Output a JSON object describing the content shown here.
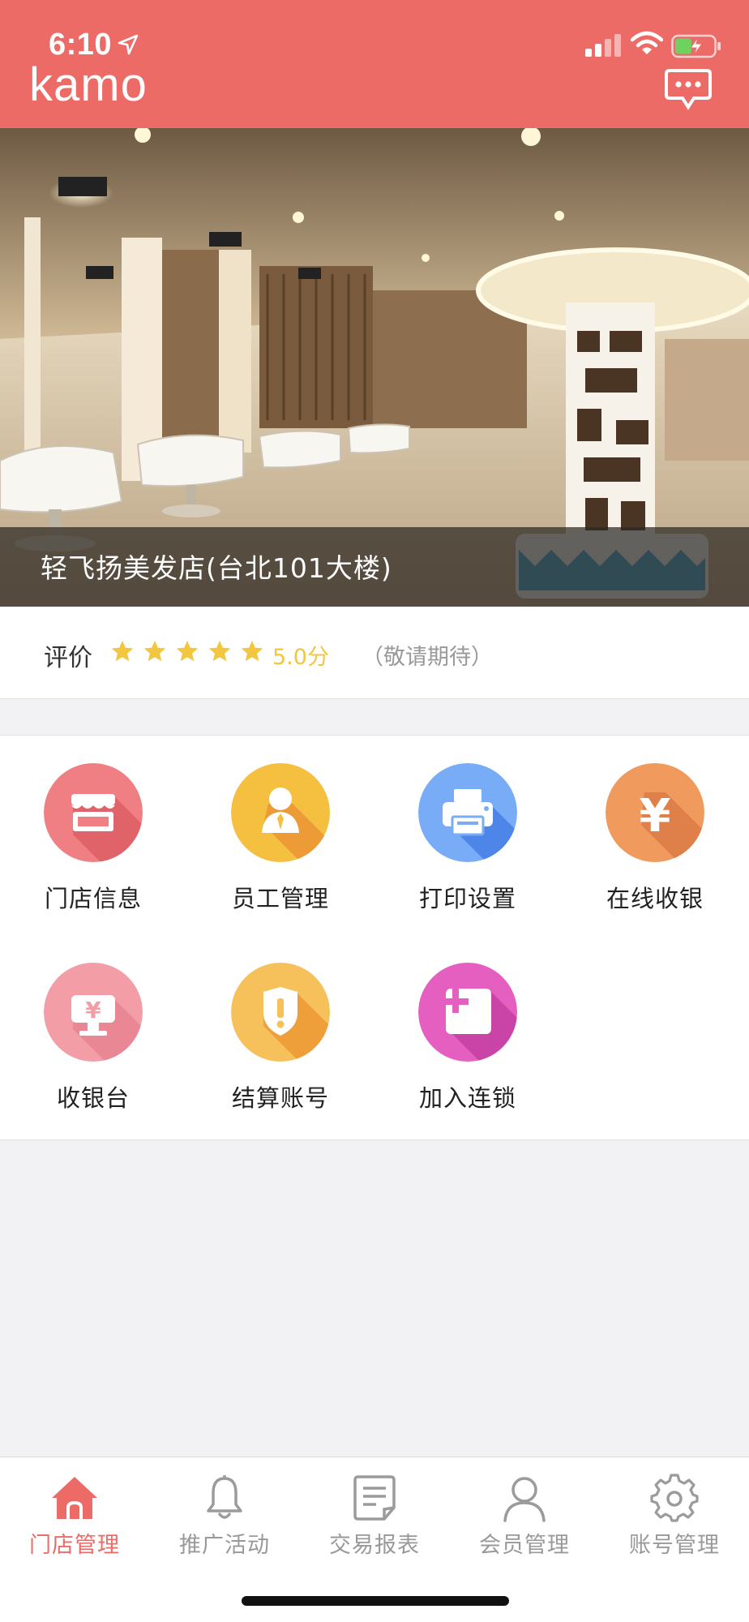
{
  "status_bar": {
    "time": "6:10"
  },
  "header": {
    "logo": "kamo",
    "message_icon": "chat-bubble-icon"
  },
  "hero": {
    "store_name": "轻飞扬美发店(台北101大楼)"
  },
  "rating": {
    "label": "评价",
    "stars": 5,
    "score": "5.0分",
    "note": "（敬请期待）"
  },
  "grid": {
    "items": [
      {
        "label": "门店信息",
        "icon": "storefront-icon",
        "color": "#f07f84"
      },
      {
        "label": "员工管理",
        "icon": "staff-icon",
        "color": "#f5bf3f"
      },
      {
        "label": "打印设置",
        "icon": "printer-icon",
        "color": "#78acf6"
      },
      {
        "label": "在线收银",
        "icon": "yen-icon",
        "color": "#f09a5e"
      },
      {
        "label": "收银台",
        "icon": "cashier-icon",
        "color": "#f39ea7"
      },
      {
        "label": "结算账号",
        "icon": "shield-alert-icon",
        "color": "#f6c15a"
      },
      {
        "label": "加入连锁",
        "icon": "join-chain-icon",
        "color": "#e45fc0"
      }
    ]
  },
  "tabbar": {
    "active_color": "#ec6b67",
    "items": [
      {
        "label": "门店管理",
        "icon": "home-icon",
        "active": true
      },
      {
        "label": "推广活动",
        "icon": "bell-icon",
        "active": false
      },
      {
        "label": "交易报表",
        "icon": "report-icon",
        "active": false
      },
      {
        "label": "会员管理",
        "icon": "user-icon",
        "active": false
      },
      {
        "label": "账号管理",
        "icon": "gear-icon",
        "active": false
      }
    ]
  },
  "colors": {
    "brand": "#ec6b67",
    "star": "#f2c640"
  }
}
